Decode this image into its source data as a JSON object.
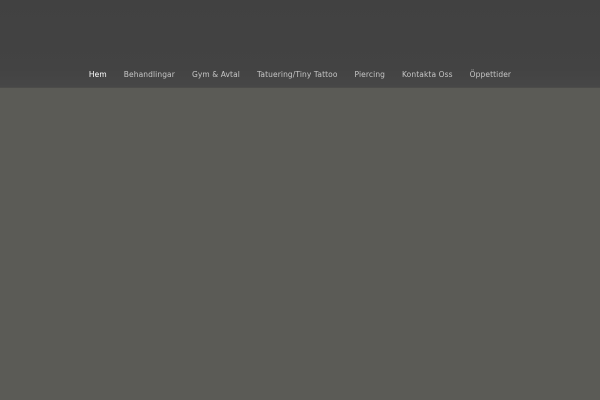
{
  "nav": {
    "items": [
      {
        "label": "Hem",
        "active": true
      },
      {
        "label": "Behandlingar",
        "active": false
      },
      {
        "label": "Gym & Avtal",
        "active": false
      },
      {
        "label": "Tatuering/Tiny Tattoo",
        "active": false
      },
      {
        "label": "Piercing",
        "active": false
      },
      {
        "label": "Kontakta Oss",
        "active": false
      },
      {
        "label": "Öppettider",
        "active": false
      }
    ]
  },
  "colors": {
    "header_background": "#424242",
    "page_background": "#5b5b56",
    "nav_text": "#c6c6c6",
    "nav_active_text": "#ffffff"
  }
}
